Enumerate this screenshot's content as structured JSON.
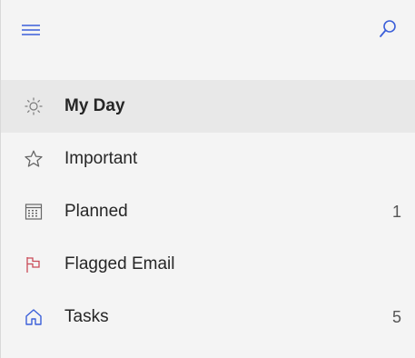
{
  "topbar": {
    "menu_icon": "hamburger-menu-icon",
    "search_icon": "search-icon"
  },
  "nav": {
    "items": [
      {
        "label": "My Day",
        "icon": "sun-icon",
        "selected": true,
        "count": ""
      },
      {
        "label": "Important",
        "icon": "star-icon",
        "selected": false,
        "count": ""
      },
      {
        "label": "Planned",
        "icon": "calendar-icon",
        "selected": false,
        "count": "1"
      },
      {
        "label": "Flagged Email",
        "icon": "flag-icon",
        "selected": false,
        "count": ""
      },
      {
        "label": "Tasks",
        "icon": "home-icon",
        "selected": false,
        "count": "5"
      }
    ]
  },
  "colors": {
    "accent": "#3b5fd9",
    "flag": "#c94a57",
    "selected_background": "#e8e8e8",
    "panel_background": "#f4f4f4"
  }
}
